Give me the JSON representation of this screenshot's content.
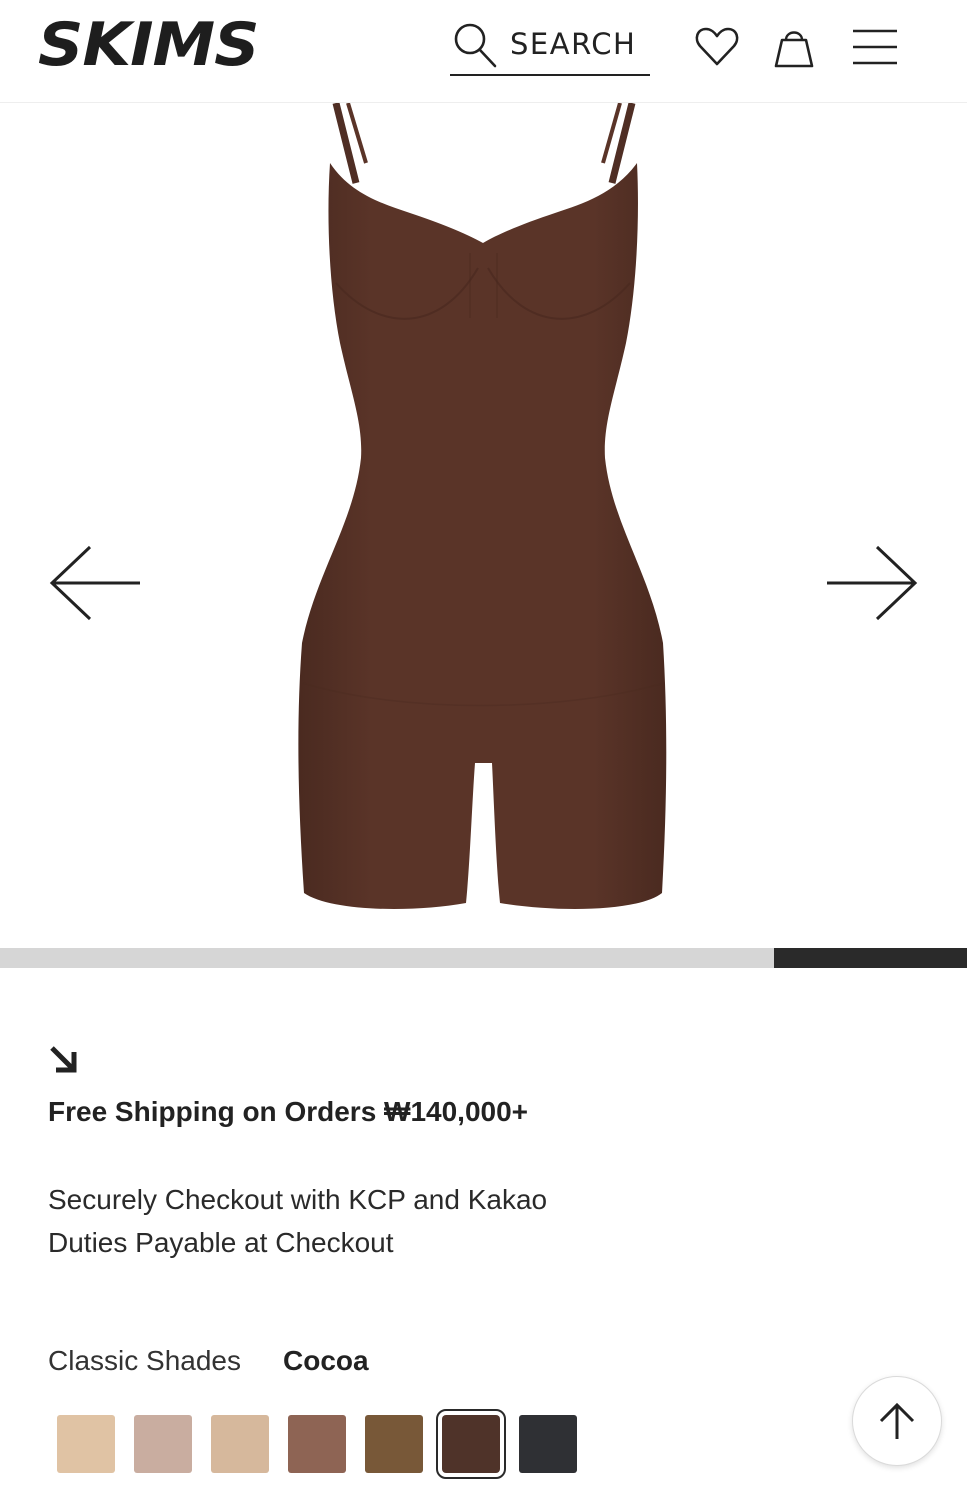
{
  "header": {
    "logo_text": "SKIMS",
    "search_label": "SEARCH",
    "icons": [
      "search-icon",
      "heart-icon",
      "shopping-bag-icon",
      "menu-icon"
    ]
  },
  "gallery": {
    "product_color_hex": "#5a3428",
    "progress_fraction": 0.2,
    "prev_icon": "arrow-left-icon",
    "next_icon": "arrow-right-icon"
  },
  "promo": {
    "icon": "arrow-down-right-icon",
    "title": "Free Shipping on Orders ₩140,000+",
    "line1": "Securely Checkout with KCP and Kakao",
    "line2": "Duties Payable at Checkout"
  },
  "shades": {
    "label": "Classic Shades",
    "selected_name": "Cocoa",
    "swatch_colors": [
      "#e0c3a4",
      "#c9ada0",
      "#d6b89c",
      "#8e6454",
      "#785838",
      "#4f3329",
      "#2f3034"
    ],
    "selected_index": 5
  },
  "scroll_top_icon": "arrow-up-icon"
}
